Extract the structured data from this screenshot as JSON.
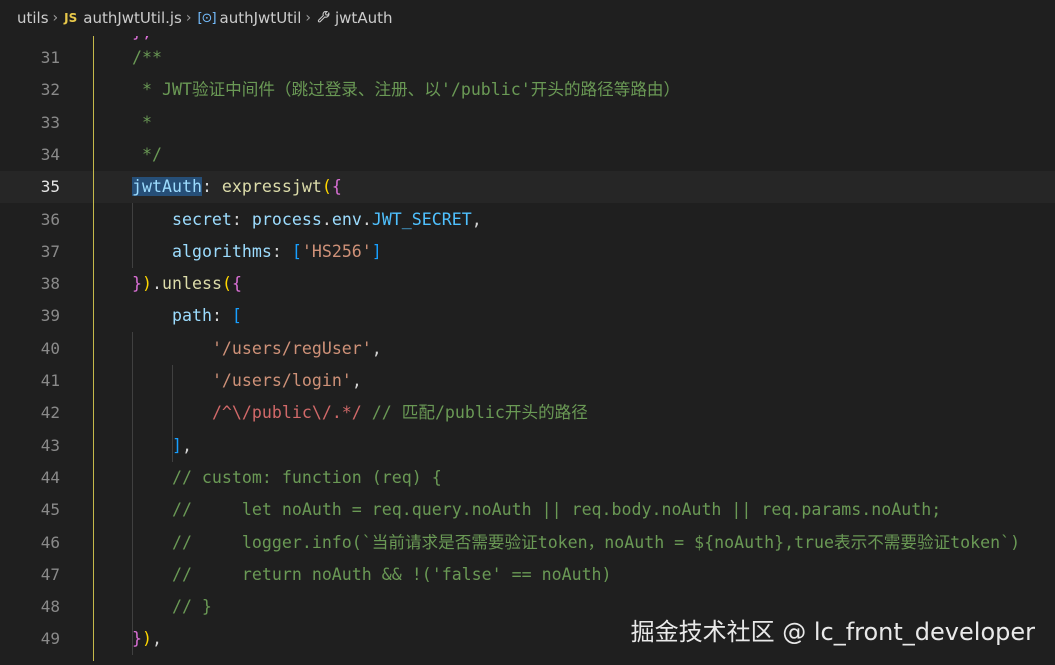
{
  "breadcrumb": {
    "folder": "utils",
    "file_icon": "JS",
    "file": "authJwtUtil.js",
    "symbol_icon": "[⊙]",
    "symbol": "authJwtUtil",
    "member": "jwtAuth"
  },
  "editor": {
    "partial_top_line": "},",
    "lines": [
      {
        "num": "31",
        "tokens": [
          {
            "t": "/**",
            "c": "com"
          }
        ]
      },
      {
        "num": "32",
        "tokens": [
          {
            "t": " * JWT验证中间件（跳过登录、注册、以'/public'开头的路径等路由）",
            "c": "com"
          }
        ]
      },
      {
        "num": "33",
        "tokens": [
          {
            "t": " *",
            "c": "com"
          }
        ]
      },
      {
        "num": "34",
        "tokens": [
          {
            "t": " */",
            "c": "com"
          }
        ]
      },
      {
        "num": "35",
        "current": true,
        "tokens": [
          {
            "t": "jwtAuth",
            "c": "prop hl"
          },
          {
            "t": ": ",
            "c": "punc"
          },
          {
            "t": "expressjwt",
            "c": "fn"
          },
          {
            "t": "(",
            "c": "br1"
          },
          {
            "t": "{",
            "c": "br2"
          }
        ]
      },
      {
        "num": "36",
        "tokens": [
          {
            "t": "    ",
            "c": "plain"
          },
          {
            "t": "secret",
            "c": "prop"
          },
          {
            "t": ": ",
            "c": "punc"
          },
          {
            "t": "process",
            "c": "prop"
          },
          {
            "t": ".",
            "c": "punc"
          },
          {
            "t": "env",
            "c": "prop"
          },
          {
            "t": ".",
            "c": "punc"
          },
          {
            "t": "JWT_SECRET",
            "c": "const"
          },
          {
            "t": ",",
            "c": "punc"
          }
        ]
      },
      {
        "num": "37",
        "tokens": [
          {
            "t": "    ",
            "c": "plain"
          },
          {
            "t": "algorithms",
            "c": "prop"
          },
          {
            "t": ": ",
            "c": "punc"
          },
          {
            "t": "[",
            "c": "br3"
          },
          {
            "t": "'HS256'",
            "c": "str"
          },
          {
            "t": "]",
            "c": "br3"
          }
        ]
      },
      {
        "num": "38",
        "tokens": [
          {
            "t": "}",
            "c": "br2"
          },
          {
            "t": ")",
            "c": "br1"
          },
          {
            "t": ".",
            "c": "punc"
          },
          {
            "t": "unless",
            "c": "fn"
          },
          {
            "t": "(",
            "c": "br1"
          },
          {
            "t": "{",
            "c": "br2"
          }
        ]
      },
      {
        "num": "39",
        "tokens": [
          {
            "t": "    ",
            "c": "plain"
          },
          {
            "t": "path",
            "c": "prop"
          },
          {
            "t": ": ",
            "c": "punc"
          },
          {
            "t": "[",
            "c": "br3"
          }
        ]
      },
      {
        "num": "40",
        "tokens": [
          {
            "t": "        ",
            "c": "plain"
          },
          {
            "t": "'/users/regUser'",
            "c": "str"
          },
          {
            "t": ",",
            "c": "punc"
          }
        ]
      },
      {
        "num": "41",
        "tokens": [
          {
            "t": "        ",
            "c": "plain"
          },
          {
            "t": "'/users/login'",
            "c": "str"
          },
          {
            "t": ",",
            "c": "punc"
          }
        ]
      },
      {
        "num": "42",
        "tokens": [
          {
            "t": "        ",
            "c": "plain"
          },
          {
            "t": "/^\\/public\\/.*/",
            "c": "regex"
          },
          {
            "t": " // 匹配/public开头的路径",
            "c": "com"
          }
        ]
      },
      {
        "num": "43",
        "tokens": [
          {
            "t": "    ",
            "c": "plain"
          },
          {
            "t": "]",
            "c": "br3"
          },
          {
            "t": ",",
            "c": "punc"
          }
        ]
      },
      {
        "num": "44",
        "tokens": [
          {
            "t": "    // custom: function (req) {",
            "c": "com"
          }
        ]
      },
      {
        "num": "45",
        "tokens": [
          {
            "t": "    //     let noAuth = req.query.noAuth || req.body.noAuth || req.params.noAuth;",
            "c": "com"
          }
        ]
      },
      {
        "num": "46",
        "tokens": [
          {
            "t": "    //     logger.info(`当前请求是否需要验证token，noAuth = ${noAuth},true表示不需要验证token`)",
            "c": "com"
          }
        ]
      },
      {
        "num": "47",
        "tokens": [
          {
            "t": "    //     return noAuth && !('false' == noAuth)",
            "c": "com"
          }
        ]
      },
      {
        "num": "48",
        "tokens": [
          {
            "t": "    // }",
            "c": "com"
          }
        ]
      },
      {
        "num": "49",
        "tokens": [
          {
            "t": "}",
            "c": "br2"
          },
          {
            "t": ")",
            "c": "br1"
          },
          {
            "t": ",",
            "c": "punc"
          }
        ]
      }
    ]
  },
  "watermark": "掘金技术社区 @ lc_front_developer"
}
